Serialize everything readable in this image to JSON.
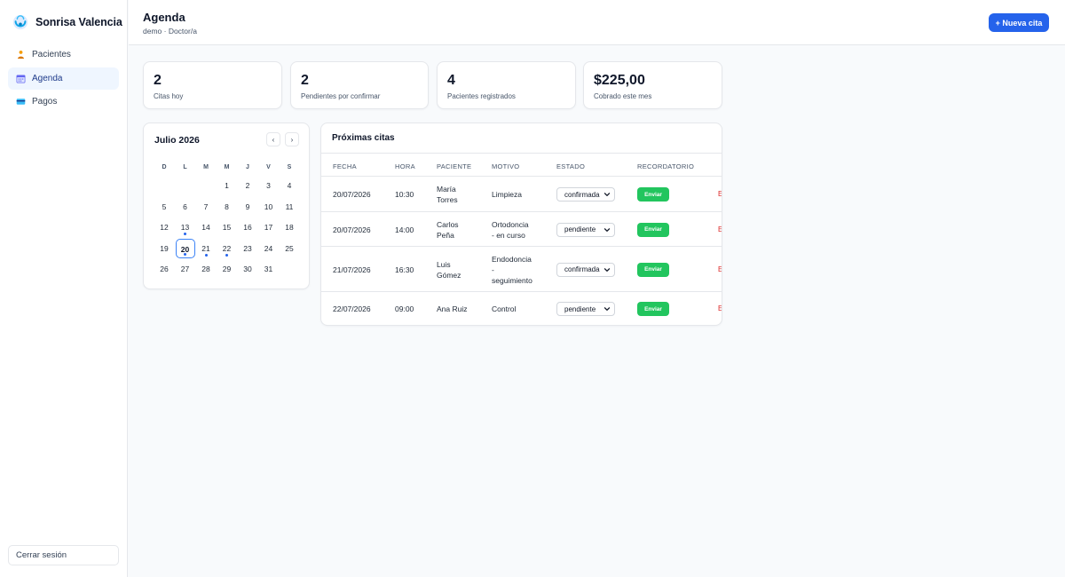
{
  "app": {
    "name": "Sonrisa Valencia"
  },
  "sidebar": {
    "items": [
      {
        "label": "Pacientes",
        "icon": "patient-icon",
        "active": false
      },
      {
        "label": "Agenda",
        "icon": "calendar-icon",
        "active": true
      },
      {
        "label": "Pagos",
        "icon": "card-icon",
        "active": false
      }
    ],
    "logout_label": "Cerrar sesión"
  },
  "header": {
    "title": "Agenda",
    "subtitle": "demo · Doctor/a",
    "new_button": "+ Nueva cita"
  },
  "stats": [
    {
      "value": "2",
      "label": "Citas hoy"
    },
    {
      "value": "2",
      "label": "Pendientes por confirmar"
    },
    {
      "value": "4",
      "label": "Pacientes registrados"
    },
    {
      "value": "$225,00",
      "label": "Cobrado este mes"
    }
  ],
  "calendar": {
    "month_label": "Julio 2026",
    "prev_label": "‹",
    "next_label": "›",
    "weekdays": [
      "D",
      "L",
      "M",
      "M",
      "J",
      "V",
      "S"
    ],
    "first_weekday": 3,
    "days_in_month": 31,
    "today": 20,
    "days_with_appointments": [
      13,
      20,
      21,
      22
    ]
  },
  "appointments": {
    "title": "Próximas citas",
    "columns": [
      "FECHA",
      "HORA",
      "PACIENTE",
      "MOTIVO",
      "ESTADO",
      "RECORDATORIO"
    ],
    "send_label": "Enviar",
    "trailing_label": "E",
    "rows": [
      {
        "date": "20/07/2026",
        "time": "10:30",
        "patient": [
          "María",
          "Torres"
        ],
        "reason": [
          "Limpieza"
        ],
        "status": "confirmada"
      },
      {
        "date": "20/07/2026",
        "time": "14:00",
        "patient": [
          "Carlos",
          "Peña"
        ],
        "reason": [
          "Ortodoncia",
          "- en curso"
        ],
        "status": "pendiente"
      },
      {
        "date": "21/07/2026",
        "time": "16:30",
        "patient": [
          "Luis",
          "Gómez"
        ],
        "reason": [
          "Endodoncia",
          "-",
          "seguimiento"
        ],
        "status": "confirmada"
      },
      {
        "date": "22/07/2026",
        "time": "09:00",
        "patient": [
          "Ana Ruiz"
        ],
        "reason": [
          "Control"
        ],
        "status": "pendiente"
      }
    ]
  },
  "colors": {
    "accent": "#2563eb",
    "success": "#22c55e",
    "danger": "#dc2626"
  }
}
